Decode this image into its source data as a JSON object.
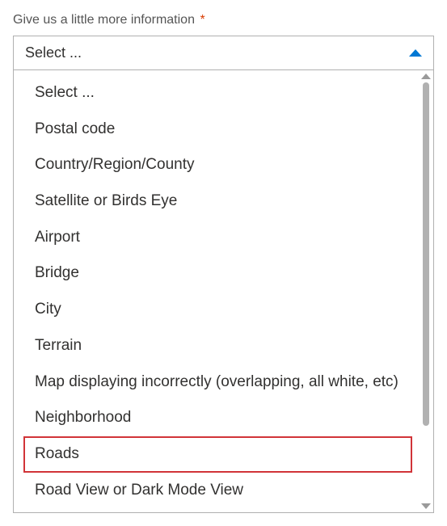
{
  "label": "Give us a little more information",
  "required_marker": "*",
  "select": {
    "placeholder": "Select ..."
  },
  "dropdown": {
    "options": [
      {
        "label": "Select ...",
        "highlighted": false
      },
      {
        "label": "Postal code",
        "highlighted": false
      },
      {
        "label": "Country/Region/County",
        "highlighted": false
      },
      {
        "label": "Satellite or Birds Eye",
        "highlighted": false
      },
      {
        "label": "Airport",
        "highlighted": false
      },
      {
        "label": "Bridge",
        "highlighted": false
      },
      {
        "label": "City",
        "highlighted": false
      },
      {
        "label": "Terrain",
        "highlighted": false
      },
      {
        "label": "Map displaying incorrectly (overlapping, all white, etc)",
        "highlighted": false
      },
      {
        "label": "Neighborhood",
        "highlighted": false
      },
      {
        "label": "Roads",
        "highlighted": true
      },
      {
        "label": "Road View or Dark Mode View",
        "highlighted": false
      }
    ]
  }
}
